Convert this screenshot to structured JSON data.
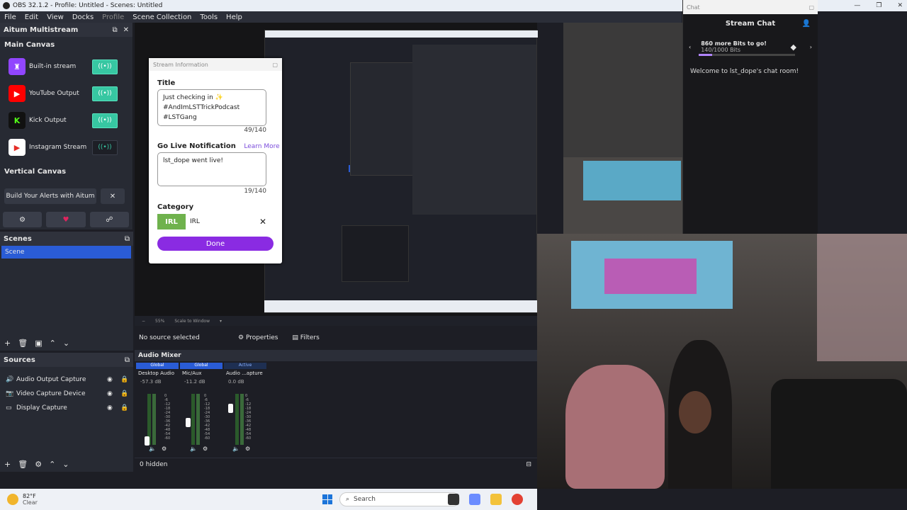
{
  "window": {
    "title": "OBS 32.1.2 - Profile: Untitled - Scenes: Untitled",
    "controls": [
      "—",
      "❐",
      "✕"
    ]
  },
  "menu": [
    "File",
    "Edit",
    "View",
    "Docks",
    "Profile",
    "Scene Collection",
    "Tools",
    "Help"
  ],
  "aitum": {
    "title": "Aitum Multistream",
    "main_canvas": "Main Canvas",
    "outputs": [
      {
        "name": "Built-in stream",
        "color": "#9146ff",
        "glyph": "♜",
        "active": true
      },
      {
        "name": "YouTube Output",
        "color": "#ff0000",
        "glyph": "▶",
        "active": true
      },
      {
        "name": "Kick Output",
        "color": "#111111",
        "glyph": "K",
        "active": true
      },
      {
        "name": "Instagram Stream",
        "color": "#ffffff",
        "glyph": "▶",
        "active": false
      }
    ],
    "live_glyph": "((•))",
    "vertical_canvas": "Vertical Canvas",
    "build_alerts": "Build Your Alerts with Aitum",
    "close_glyph": "✕"
  },
  "scenes": {
    "title": "Scenes",
    "items": [
      "Scene"
    ]
  },
  "sources": {
    "title": "Sources",
    "items": [
      {
        "icon": "speaker-icon",
        "glyph": "🔊",
        "name": "Audio Output Capture"
      },
      {
        "icon": "camera-icon",
        "glyph": "📷",
        "name": "Video Capture Device"
      },
      {
        "icon": "monitor-icon",
        "glyph": "▭",
        "name": "Display Capture"
      }
    ]
  },
  "dialog": {
    "title": "Stream Information",
    "title_label": "Title",
    "title_value_1": "Just checking in ✨",
    "title_value_2": "#AndImLSTTrickPodcast",
    "title_value_3": "#LSTGang",
    "title_count": "49/140",
    "notif_label": "Go Live Notification",
    "learn_more": "Learn More",
    "notif_value": "lst_dope went live!",
    "notif_count": "19/140",
    "category_label": "Category",
    "category_thumb": "IRL",
    "category_value": "IRL",
    "done": "Done"
  },
  "preview": {
    "zoom": "55%",
    "scale_mode": "Scale to Window"
  },
  "props": {
    "no_source": "No source selected",
    "properties": "Properties",
    "filters": "Filters"
  },
  "mixer": {
    "title": "Audio Mixer",
    "channels": [
      {
        "tag": "Global",
        "name": "Desktop Audio",
        "db": "-57.3 dB",
        "level": 0.1
      },
      {
        "tag": "Global",
        "name": "Mic/Aux",
        "db": "-11.2 dB",
        "level": 0.6
      },
      {
        "tag": "Active",
        "name": "Audio ...apture",
        "db": "0.0 dB",
        "level": 0.95
      }
    ],
    "scale": [
      "0",
      "-6",
      "-12",
      "-18",
      "-24",
      "-30",
      "-36",
      "-42",
      "-48",
      "-54",
      "-60"
    ],
    "hidden": "0 hidden"
  },
  "chat": {
    "window_title": "Chat",
    "title": "Stream Chat",
    "bits_goal": "860 more Bits to go!",
    "bits_progress": "140/1000 Bits",
    "bits_fraction": 0.14,
    "welcome": "Welcome to lst_dope's chat room!"
  },
  "taskbar": {
    "temp": "82°F",
    "condition": "Clear",
    "search": "Search"
  }
}
